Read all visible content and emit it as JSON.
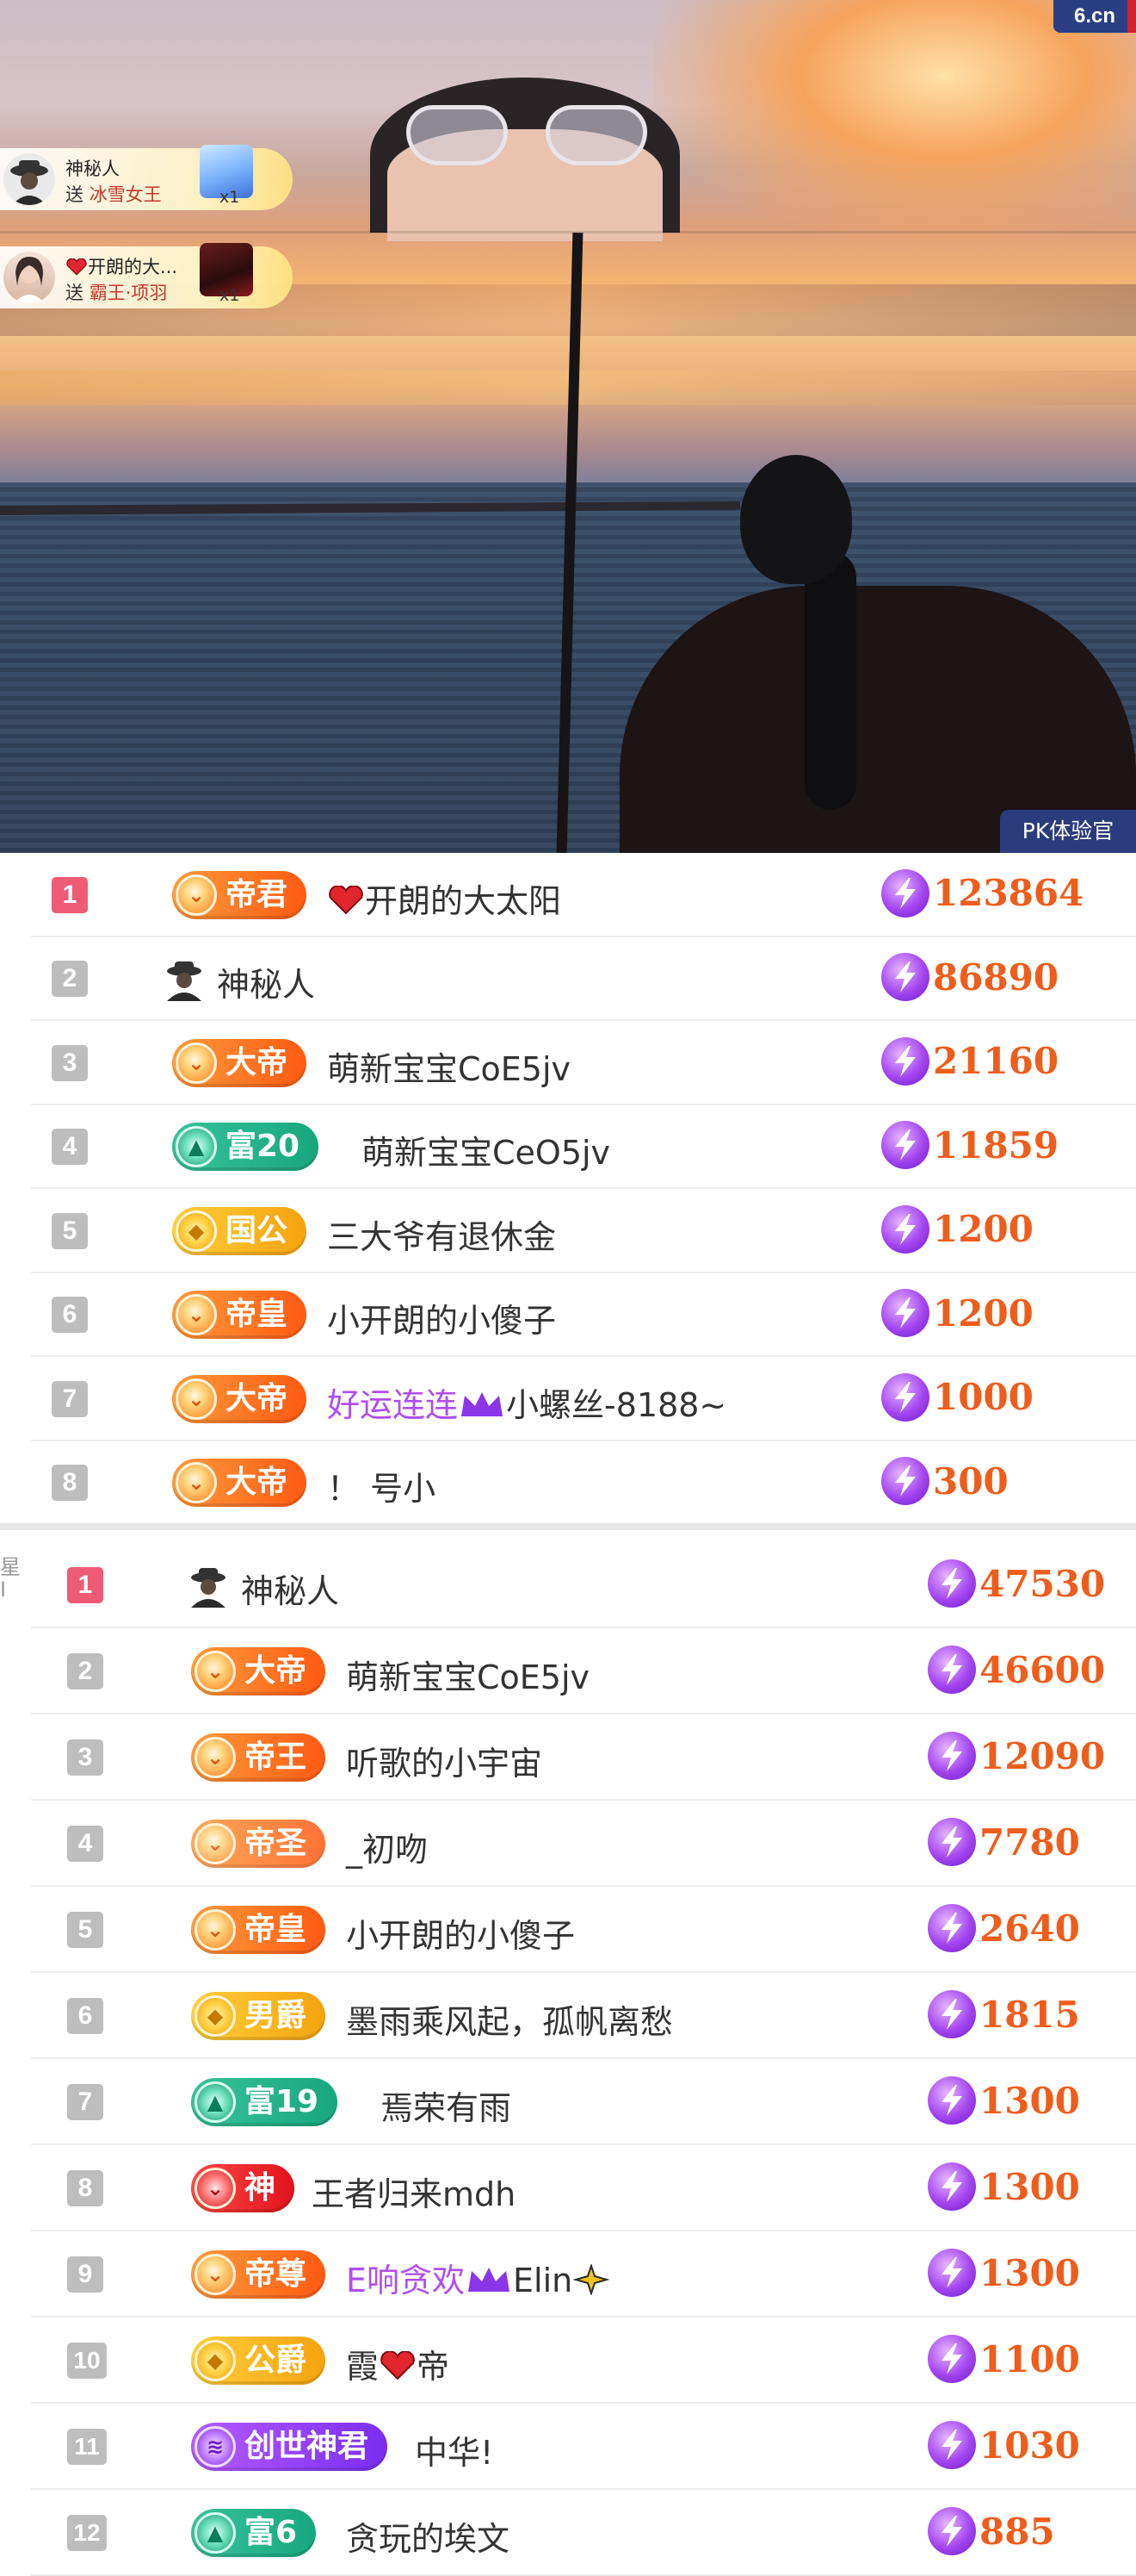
{
  "stream": {
    "site_badge": "6.cn",
    "pk_badge": "PK体验官",
    "gift_notifications": [
      {
        "user": "神秘人",
        "action": "送",
        "gift": "冰雪女王",
        "count": "x1",
        "avatar_icon": "mystery-user-icon"
      },
      {
        "user": "开朗的大...",
        "action": "送",
        "gift": "霸王·项羽",
        "count": "x1",
        "avatar_icon": "user-avatar"
      }
    ]
  },
  "lists": [
    {
      "rows": [
        {
          "rank": "1",
          "badge": "帝君",
          "badge_style": "orange",
          "name": "开朗的大太阳",
          "prefix_icon": "heart-icon",
          "score": "123864"
        },
        {
          "rank": "2",
          "badge": "",
          "badge_style": "none",
          "name": "神秘人",
          "prefix_icon": "mystery-user-icon",
          "score": "86890"
        },
        {
          "rank": "3",
          "badge": "大帝",
          "badge_style": "orange",
          "name": "萌新宝宝CoE5jv",
          "score": "21160"
        },
        {
          "rank": "4",
          "badge": "富20",
          "badge_style": "teal",
          "name": "萌新宝宝CeO5jv",
          "score": "11859"
        },
        {
          "rank": "5",
          "badge": "国公",
          "badge_style": "gold",
          "name": "三大爷有退休金",
          "score": "1200"
        },
        {
          "rank": "6",
          "badge": "帝皇",
          "badge_style": "orange",
          "name": "小开朗的小傻子",
          "score": "1200"
        },
        {
          "rank": "7",
          "badge": "大帝",
          "badge_style": "orange",
          "name_purple": "好运连连",
          "name": "小螺丝-8188~",
          "mid_icon": "crown-icon",
          "score": "1000"
        },
        {
          "rank": "8",
          "badge": "大帝",
          "badge_style": "orange",
          "name": "！ 号小",
          "score": "300"
        }
      ]
    },
    {
      "edge_text": "星 I",
      "rows": [
        {
          "rank": "1",
          "badge": "",
          "badge_style": "none",
          "name": "神秘人",
          "prefix_icon": "mystery-user-icon",
          "score": "47530"
        },
        {
          "rank": "2",
          "badge": "大帝",
          "badge_style": "orange",
          "name": "萌新宝宝CoE5jv",
          "score": "46600"
        },
        {
          "rank": "3",
          "badge": "帝王",
          "badge_style": "orange",
          "name": "听歌的小宇宙",
          "score": "12090"
        },
        {
          "rank": "4",
          "badge": "帝圣",
          "badge_style": "orange faded",
          "name": "_初吻",
          "score": "7780"
        },
        {
          "rank": "5",
          "badge": "帝皇",
          "badge_style": "orange",
          "name": "小开朗的小傻子",
          "score": "2640"
        },
        {
          "rank": "6",
          "badge": "男爵",
          "badge_style": "gold",
          "name": "墨雨乘风起，孤帆离愁",
          "score": "1815"
        },
        {
          "rank": "7",
          "badge": "富19",
          "badge_style": "teal",
          "name": "焉荣有雨",
          "score": "1300"
        },
        {
          "rank": "8",
          "badge": "神",
          "badge_style": "red",
          "name": "王者归来mdh",
          "score": "1300"
        },
        {
          "rank": "9",
          "badge": "帝尊",
          "badge_style": "orange",
          "name_purple": "E响贪欢",
          "name": "Elin",
          "mid_icon": "crown-icon",
          "suffix_icon": "sparkle-icon",
          "score": "1300"
        },
        {
          "rank": "10",
          "badge": "公爵",
          "badge_style": "gold",
          "name": "霞",
          "name_after": "帝",
          "mid_icon": "heart-icon",
          "score": "1100"
        },
        {
          "rank": "11",
          "badge": "创世神君",
          "badge_style": "purple",
          "name": "中华!",
          "score": "1030"
        },
        {
          "rank": "12",
          "badge": "富6",
          "badge_style": "teal",
          "name": "贪玩的埃文",
          "score": "885"
        }
      ]
    }
  ],
  "colors": {
    "score": "#ee5d1c",
    "rank_first": "#ef5a75",
    "rank_other": "#bdbdbd",
    "name_purple": "#b04df2"
  }
}
